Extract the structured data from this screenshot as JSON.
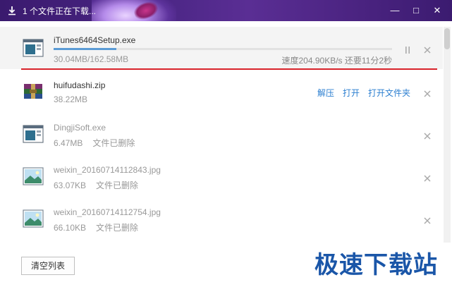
{
  "title_bar": {
    "title": "1 个文件正在下载...",
    "minimize": "—",
    "maximize": "□",
    "close": "✕"
  },
  "downloads": [
    {
      "name": "iTunes6464Setup.exe",
      "size": "30.04MB/162.58MB",
      "speed": "速度204.90KB/s 还要11分2秒",
      "progress": 0.185,
      "icon": "exe-file-icon",
      "active": true
    },
    {
      "name": "huifudashi.zip",
      "size": "38.22MB",
      "icon": "zip-archive-icon",
      "actions": [
        "解压",
        "打开",
        "打开文件夹"
      ]
    },
    {
      "name": "DingjiSoft.exe",
      "size": "6.47MB",
      "status": "文件已删除",
      "icon": "exe-file-icon"
    },
    {
      "name": "weixin_20160714112843.jpg",
      "size": "63.07KB",
      "status": "文件已删除",
      "icon": "image-file-icon"
    },
    {
      "name": "weixin_20160714112754.jpg",
      "size": "66.10KB",
      "status": "文件已删除",
      "icon": "image-file-icon"
    }
  ],
  "footer": {
    "clear_button": "清空列表",
    "watermark": "极速下载站"
  },
  "colors": {
    "title_bar": "#4b2685",
    "progress": "#5b9bd5",
    "accent_line": "#d8232a",
    "link": "#2c7fd0",
    "watermark": "#1a56a8"
  }
}
